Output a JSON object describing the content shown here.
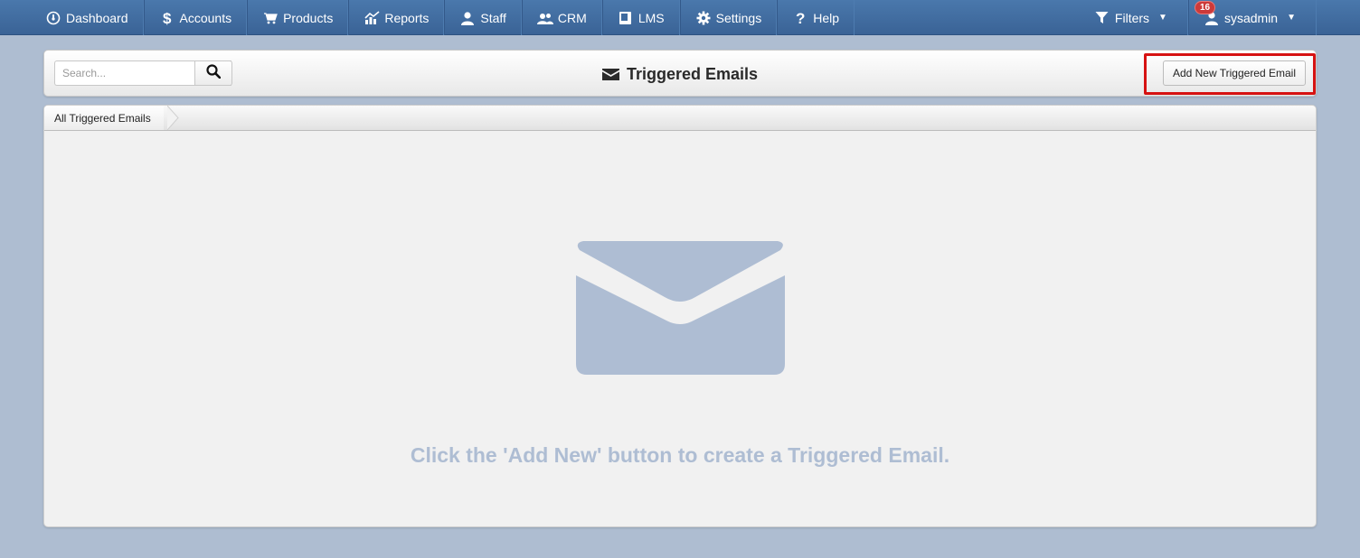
{
  "nav": {
    "items": [
      {
        "label": "Dashboard",
        "icon": "dashboard-icon"
      },
      {
        "label": "Accounts",
        "icon": "dollar-icon"
      },
      {
        "label": "Products",
        "icon": "cart-icon"
      },
      {
        "label": "Reports",
        "icon": "chart-icon"
      },
      {
        "label": "Staff",
        "icon": "person-icon"
      },
      {
        "label": "CRM",
        "icon": "people-icon"
      },
      {
        "label": "LMS",
        "icon": "book-icon"
      },
      {
        "label": "Settings",
        "icon": "gear-icon"
      },
      {
        "label": "Help",
        "icon": "question-icon"
      }
    ],
    "filters_label": "Filters",
    "user_label": "sysadmin",
    "notification_count": "16"
  },
  "header": {
    "search_placeholder": "Search...",
    "title": "Triggered Emails",
    "add_button_label": "Add New Triggered Email"
  },
  "breadcrumb": {
    "label": "All Triggered Emails"
  },
  "empty_state": {
    "message": "Click the 'Add New' button to create a Triggered Email.",
    "icon": "envelope-icon"
  },
  "colors": {
    "nav_bg": "#3f6b9f",
    "page_bg": "#aebdd1",
    "highlight": "#d61212",
    "empty_accent": "#aebdd3"
  }
}
